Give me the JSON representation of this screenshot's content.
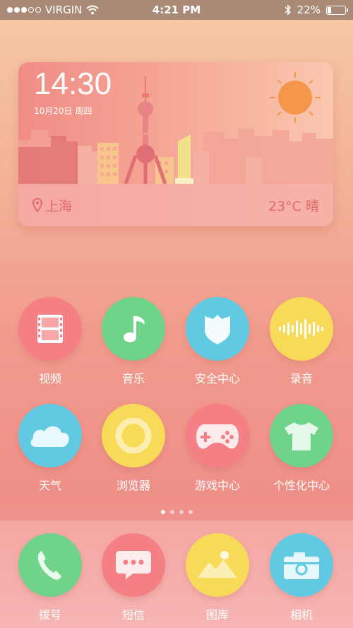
{
  "status_bar": {
    "carrier": "VIRGIN",
    "time": "4:21 PM",
    "battery_percent": "22%",
    "battery_level": 0.22
  },
  "weather": {
    "time": "14:30",
    "date": "10月20日 周四",
    "location": "上海",
    "temperature": "23°C",
    "condition": "晴"
  },
  "apps": [
    {
      "label": "视频",
      "color": "#f47f84",
      "icon": "film-icon"
    },
    {
      "label": "音乐",
      "color": "#6fd38a",
      "icon": "music-note-icon"
    },
    {
      "label": "安全中心",
      "color": "#62c9e3",
      "icon": "shield-icon"
    },
    {
      "label": "录音",
      "color": "#f7da57",
      "icon": "sound-wave-icon"
    },
    {
      "label": "天气",
      "color": "#62c9e3",
      "icon": "cloud-icon"
    },
    {
      "label": "浏览器",
      "color": "#f7da57",
      "icon": "ring-icon"
    },
    {
      "label": "游戏中心",
      "color": "#f47f84",
      "icon": "gamepad-icon"
    },
    {
      "label": "个性化中心",
      "color": "#6fd38a",
      "icon": "tshirt-icon"
    }
  ],
  "dock": [
    {
      "label": "拨号",
      "color": "#6fd38a",
      "icon": "phone-icon"
    },
    {
      "label": "短信",
      "color": "#f47f84",
      "icon": "message-icon"
    },
    {
      "label": "图库",
      "color": "#f7da57",
      "icon": "gallery-icon"
    },
    {
      "label": "相机",
      "color": "#62c9e3",
      "icon": "camera-icon"
    }
  ],
  "pages": {
    "count": 4,
    "active": 0
  }
}
